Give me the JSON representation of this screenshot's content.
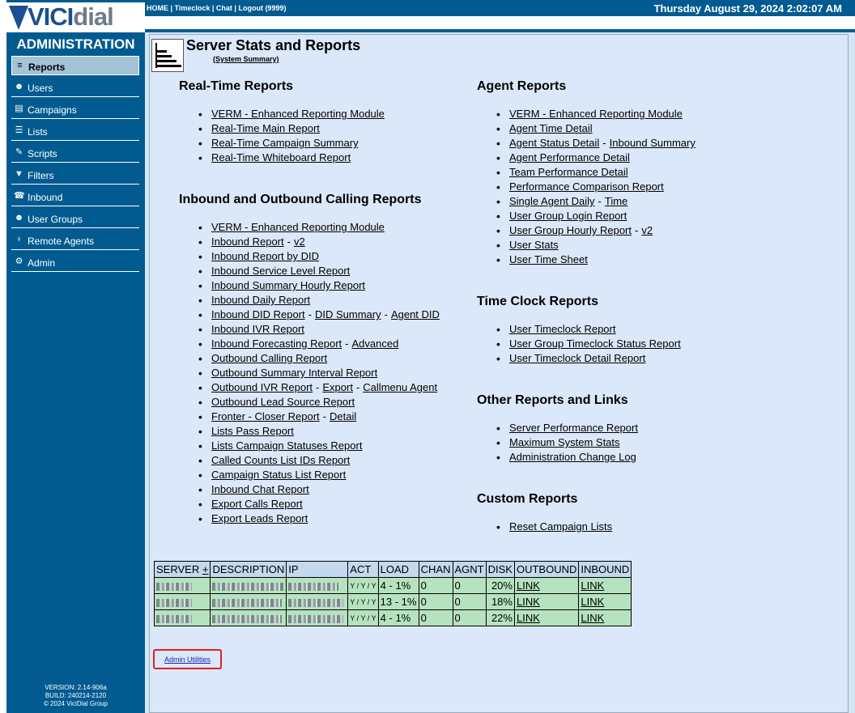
{
  "topbar": {
    "links": [
      "HOME",
      "Timeclock",
      "Chat",
      "Logout (9999)"
    ],
    "datetime": "Thursday August 29, 2024 2:02:07 AM"
  },
  "sidebar": {
    "logo": {
      "brand_a": "VICI",
      "brand_b": "dial"
    },
    "title": "ADMINISTRATION",
    "items": [
      {
        "label": "Reports",
        "icon": "bar-chart-icon",
        "glyph": "≡"
      },
      {
        "label": "Users",
        "icon": "users-icon",
        "glyph": "☻"
      },
      {
        "label": "Campaigns",
        "icon": "campaigns-icon",
        "glyph": "▤"
      },
      {
        "label": "Lists",
        "icon": "list-icon",
        "glyph": "☰"
      },
      {
        "label": "Scripts",
        "icon": "scripts-icon",
        "glyph": "✎"
      },
      {
        "label": "Filters",
        "icon": "filter-icon",
        "glyph": "▼"
      },
      {
        "label": "Inbound",
        "icon": "inbound-icon",
        "glyph": "☎"
      },
      {
        "label": "User Groups",
        "icon": "user-groups-icon",
        "glyph": "☻"
      },
      {
        "label": "Remote Agents",
        "icon": "remote-agents-icon",
        "glyph": "♀"
      },
      {
        "label": "Admin",
        "icon": "gear-icon",
        "glyph": "⚙"
      }
    ],
    "version": "VERSION: 2.14-906a",
    "build": "BUILD: 240214-2120",
    "copyright": "© 2024 ViciDial Group"
  },
  "header": {
    "title": "Server Stats and Reports",
    "subtitle": "(System Summary)"
  },
  "sections": {
    "realtime": {
      "title": "Real-Time Reports",
      "items": [
        [
          "VERM - Enhanced Reporting Module"
        ],
        [
          "Real-Time Main Report"
        ],
        [
          "Real-Time Campaign Summary"
        ],
        [
          "Real-Time Whiteboard Report"
        ]
      ]
    },
    "inout": {
      "title": "Inbound and Outbound Calling Reports",
      "items": [
        [
          "VERM - Enhanced Reporting Module"
        ],
        [
          "Inbound Report",
          "v2"
        ],
        [
          "Inbound Report by DID"
        ],
        [
          "Inbound Service Level Report"
        ],
        [
          "Inbound Summary Hourly Report"
        ],
        [
          "Inbound Daily Report"
        ],
        [
          "Inbound DID Report",
          "DID Summary",
          "Agent DID"
        ],
        [
          "Inbound IVR Report"
        ],
        [
          "Inbound Forecasting Report",
          "Advanced"
        ],
        [
          "Outbound Calling Report"
        ],
        [
          "Outbound Summary Interval Report"
        ],
        [
          "Outbound IVR Report",
          "Export",
          "Callmenu Agent"
        ],
        [
          "Outbound Lead Source Report"
        ],
        [
          "Fronter - Closer Report",
          "Detail"
        ],
        [
          "Lists Pass Report"
        ],
        [
          "Lists Campaign Statuses Report"
        ],
        [
          "Called Counts List IDs Report"
        ],
        [
          "Campaign Status List Report"
        ],
        [
          "Inbound Chat Report"
        ],
        [
          "Export Calls Report"
        ],
        [
          "Export Leads Report"
        ]
      ]
    },
    "agent": {
      "title": "Agent Reports",
      "items": [
        [
          "VERM - Enhanced Reporting Module"
        ],
        [
          "Agent Time Detail"
        ],
        [
          "Agent Status Detail",
          "Inbound Summary"
        ],
        [
          "Agent Performance Detail"
        ],
        [
          "Team Performance Detail"
        ],
        [
          "Performance Comparison Report"
        ],
        [
          "Single Agent Daily",
          "Time"
        ],
        [
          "User Group Login Report"
        ],
        [
          "User Group Hourly Report",
          "v2"
        ],
        [
          "User Stats"
        ],
        [
          "User Time Sheet"
        ]
      ]
    },
    "timeclock": {
      "title": "Time Clock Reports",
      "items": [
        [
          "User Timeclock Report"
        ],
        [
          "User Group Timeclock Status Report"
        ],
        [
          "User Timeclock Detail Report"
        ]
      ]
    },
    "other": {
      "title": "Other Reports and Links",
      "items": [
        [
          "Server Performance Report"
        ],
        [
          "Maximum System Stats"
        ],
        [
          "Administration Change Log"
        ]
      ]
    },
    "custom": {
      "title": "Custom Reports",
      "items": [
        [
          "Reset Campaign Lists"
        ]
      ]
    }
  },
  "server_table": {
    "headers": [
      "SERVER",
      "+",
      "DESCRIPTION",
      "IP",
      "ACT",
      "LOAD",
      "CHAN",
      "AGNT",
      "DISK",
      "OUTBOUND",
      "INBOUND"
    ],
    "rows": [
      {
        "act": "Y / Y / Y",
        "load": "4 - 1%",
        "chan": "0",
        "agnt": "0",
        "disk": "20%",
        "outbound": "LINK",
        "inbound": "LINK"
      },
      {
        "act": "Y / Y / Y",
        "load": "13 - 1%",
        "chan": "0",
        "agnt": "0",
        "disk": "18%",
        "outbound": "LINK",
        "inbound": "LINK"
      },
      {
        "act": "Y / Y / Y",
        "load": "4 - 1%",
        "chan": "0",
        "agnt": "0",
        "disk": "22%",
        "outbound": "LINK",
        "inbound": "LINK"
      }
    ]
  },
  "admin_utilities": "Admin Utilities"
}
